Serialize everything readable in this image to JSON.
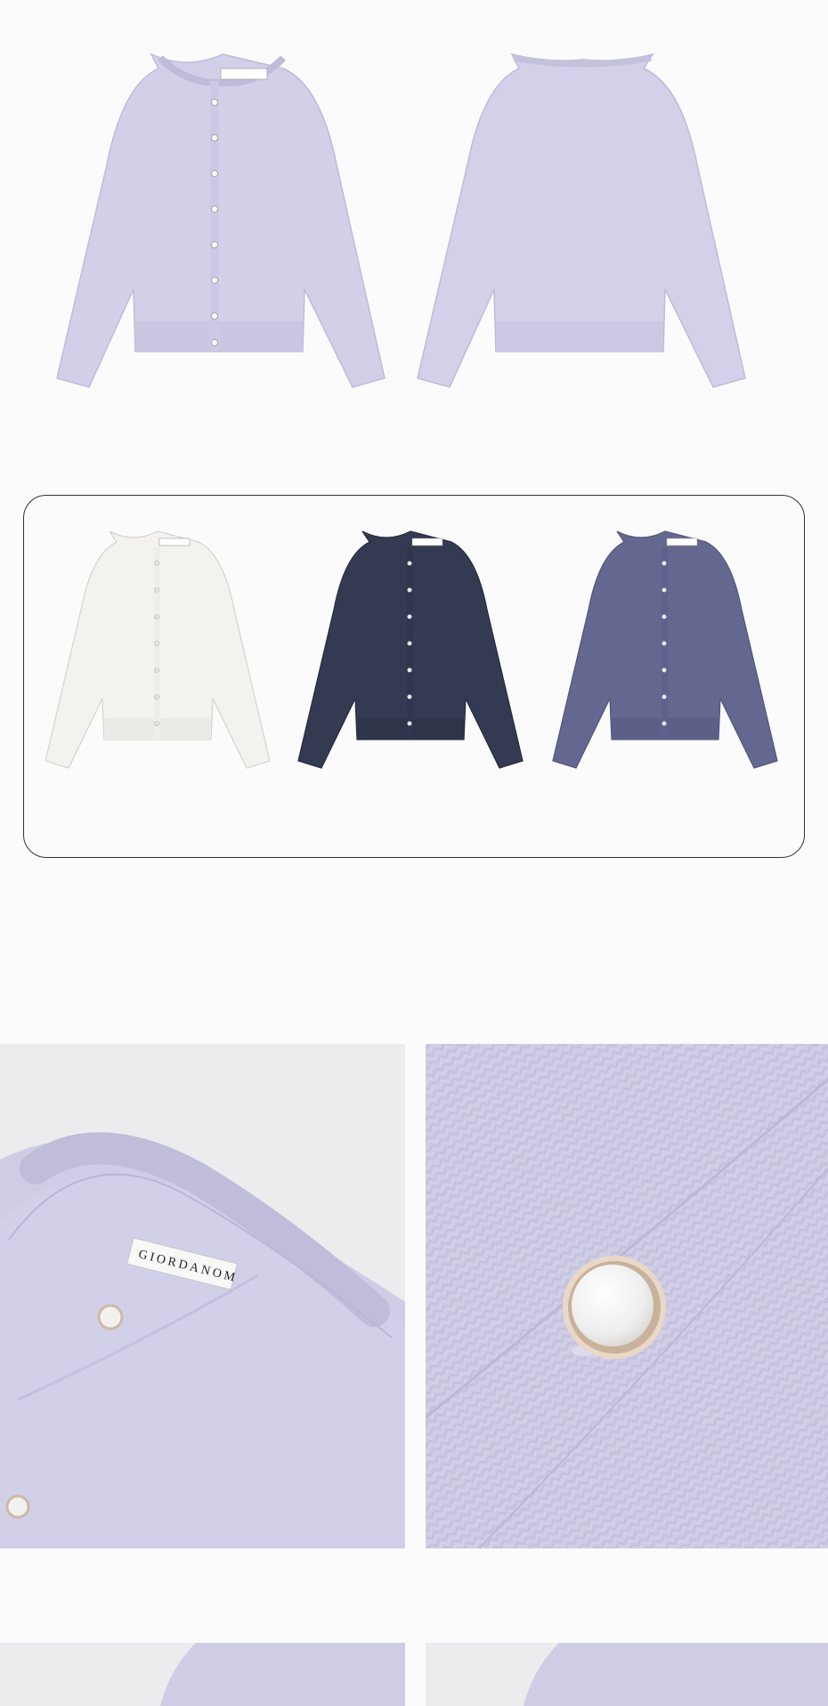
{
  "product": {
    "hero_views": [
      {
        "name": "front",
        "color": "#d2d0e8"
      },
      {
        "name": "back",
        "color": "#d3d1e9"
      }
    ],
    "variants": [
      {
        "name": "white",
        "color": "#f3f2ee",
        "button": "#e6e4e0"
      },
      {
        "name": "navy",
        "color": "#343a52",
        "button": "#e8e8ec"
      },
      {
        "name": "slate",
        "color": "#646890",
        "button": "#e8e8ec"
      }
    ],
    "neck_label_text": "GIORDANOM",
    "knit_color": "#cdcae4",
    "button_color": "#f2f1f0",
    "button_rim_color": "#cdb9a6"
  }
}
